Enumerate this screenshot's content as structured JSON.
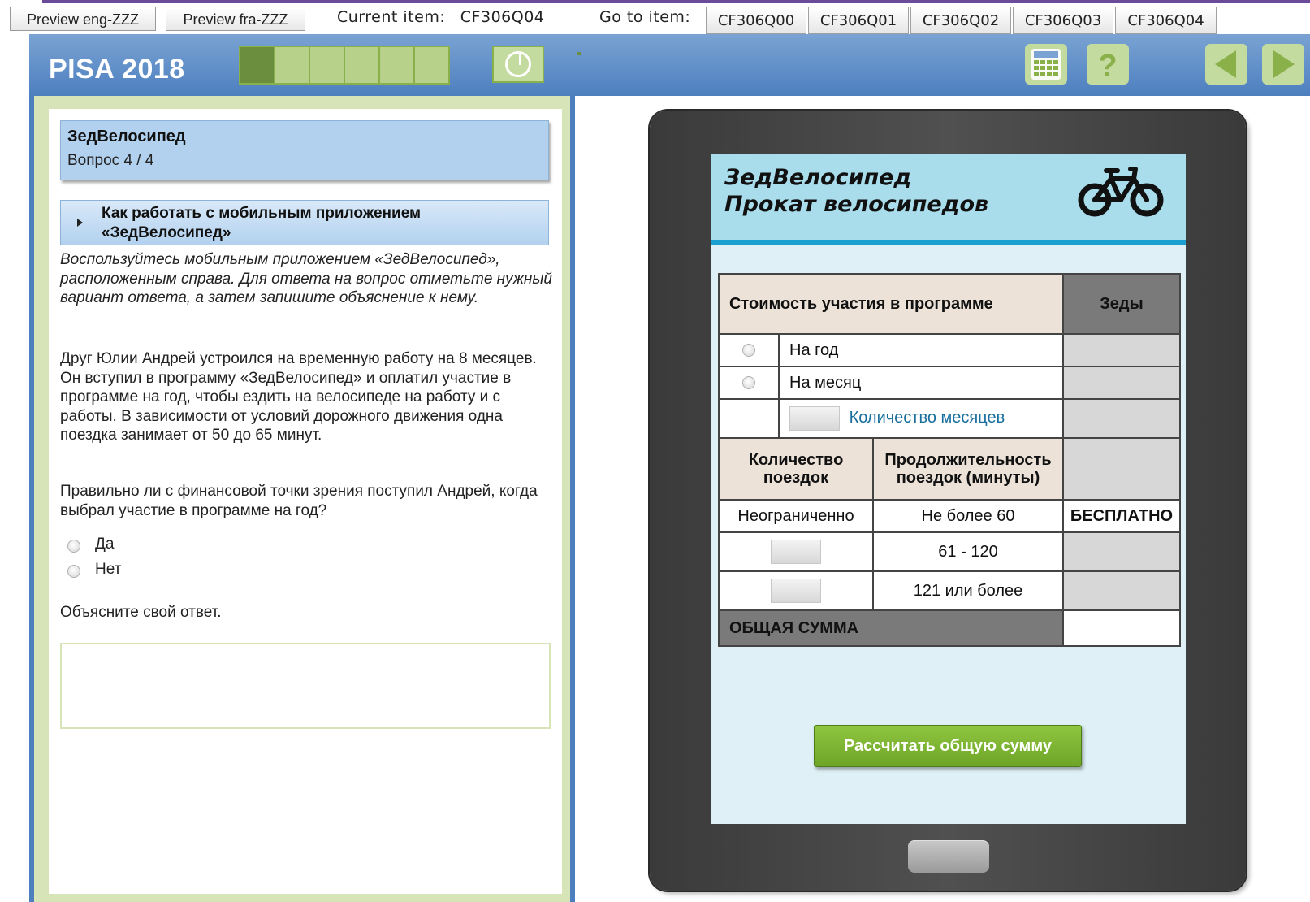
{
  "toolbar": {
    "preview_eng": "Preview eng-ZZZ",
    "preview_fra": "Preview fra-ZZZ",
    "current_item_label": "Current item:",
    "current_item_value": "CF306Q04",
    "goto_label": "Go to item:",
    "goto_items": [
      "CF306Q00",
      "CF306Q01",
      "CF306Q02",
      "CF306Q03",
      "CF306Q04"
    ]
  },
  "header": {
    "logo": "PISA 2018",
    "progress": {
      "segments": 7,
      "current": 2
    },
    "icons": [
      "calculator-icon",
      "help-icon",
      "back-arrow-icon",
      "forward-arrow-icon"
    ]
  },
  "left": {
    "title": "ЗедВелосипед",
    "question_counter": "Вопрос 4 / 4",
    "instructions_header": "Как работать с мобильным приложением «ЗедВелосипед»",
    "intro": "Воспользуйтесь мобильным приложением «ЗедВелосипед», расположенным справа. Для ответа на вопрос отметьте нужный вариант ответа, а затем запишите объяснение к нему.",
    "story": "Друг Юлии Андрей устроился на временную работу на 8 месяцев. Он вступил в программу «ЗедВелосипед» и оплатил участие в программе на год, чтобы ездить на велосипеде на работу и с работы. В зависимости от условий дорожного движения одна поездка занимает от 50 до 65 минут.",
    "question": "Правильно ли с финансовой точки зрения поступил Андрей, когда выбрал участие в программе на год?",
    "options": [
      "Да",
      "Нет"
    ],
    "explain_prompt": "Объясните свой ответ.",
    "answer_value": ""
  },
  "app": {
    "title_line1": "ЗедВелосипед",
    "title_line2": "Прокат велосипедов",
    "table": {
      "membership_header": "Стоимость участия в программе",
      "zeds_header": "Зеды",
      "year": "На год",
      "month": "На месяц",
      "months_count": "Количество месяцев",
      "trips_header": "Количество поездок",
      "duration_header": "Продолжительность поездок (минуты)",
      "unlimited": "Неограниченно",
      "dur1": "Не более 60",
      "dur2": "61 - 120",
      "dur3": "121 или более",
      "free": "БЕСПЛАТНО",
      "total": "ОБЩАЯ СУММА"
    },
    "calculate_button": "Рассчитать общую сумму"
  },
  "colors": {
    "header_blue": "#4d7fbf",
    "frame_green": "#d6e4b8",
    "app_header": "#a9ddec",
    "button_green": "#7cb733"
  }
}
